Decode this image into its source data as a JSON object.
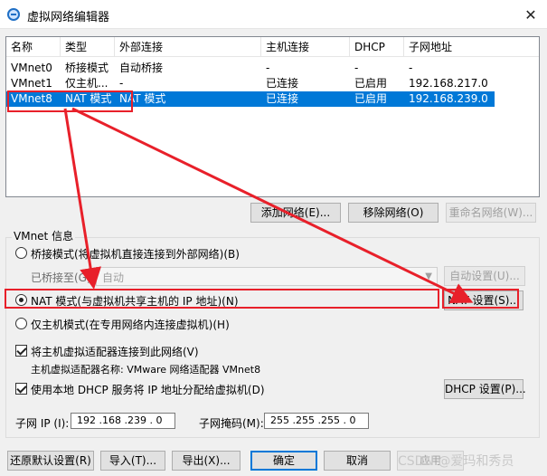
{
  "window": {
    "title": "虚拟网络编辑器",
    "close": "✕"
  },
  "table": {
    "headers": [
      "名称",
      "类型",
      "外部连接",
      "主机连接",
      "DHCP",
      "子网地址"
    ],
    "rows": [
      [
        "VMnet0",
        "桥接模式",
        "自动桥接",
        "-",
        "-",
        "-"
      ],
      [
        "VMnet1",
        "仅主机...",
        "-",
        "已连接",
        "已启用",
        "192.168.217.0"
      ],
      [
        "VMnet8",
        "NAT 模式",
        "NAT 模式",
        "已连接",
        "已启用",
        "192.168.239.0"
      ]
    ],
    "selected_row": 2
  },
  "list_buttons": {
    "add": "添加网络(E)...",
    "remove": "移除网络(O)",
    "rename": "重命名网络(W)..."
  },
  "vmnet_info": {
    "group_title": "VMnet 信息",
    "bridge_option": "桥接模式(将虚拟机直接连接到外部网络)(B)",
    "bridged_to_label": "已桥接至(G):",
    "bridged_to_value": "自动",
    "auto_settings": "自动设置(U)...",
    "nat_option": "NAT 模式(与虚拟机共享主机的 IP 地址)(N)",
    "nat_settings": "NAT 设置(S)...",
    "host_only_option": "仅主机模式(在专用网络内连接虚拟机)(H)",
    "connect_adapter": "将主机虚拟适配器连接到此网络(V)",
    "adapter_name": "主机虚拟适配器名称: VMware 网络适配器 VMnet8",
    "use_dhcp": "使用本地 DHCP 服务将 IP 地址分配给虚拟机(D)",
    "dhcp_settings": "DHCP 设置(P)...",
    "subnet_ip_label": "子网 IP (I):",
    "subnet_ip_value": "192 .168 .239 .  0",
    "subnet_mask_label": "子网掩码(M):",
    "subnet_mask_value": "255 .255 .255 .  0",
    "selected_mode": "nat",
    "connect_adapter_checked": true,
    "use_dhcp_checked": true
  },
  "bottom_buttons": {
    "restore": "还原默认设置(R)",
    "import": "导入(T)...",
    "export": "导出(X)...",
    "ok": "确定",
    "cancel": "取消",
    "apply": "应用"
  },
  "watermark": "CSDN @爱玛和秀员",
  "colors": {
    "selection": "#0078d7",
    "annotation": "#e8202a",
    "accent_border": "#0078d7"
  }
}
